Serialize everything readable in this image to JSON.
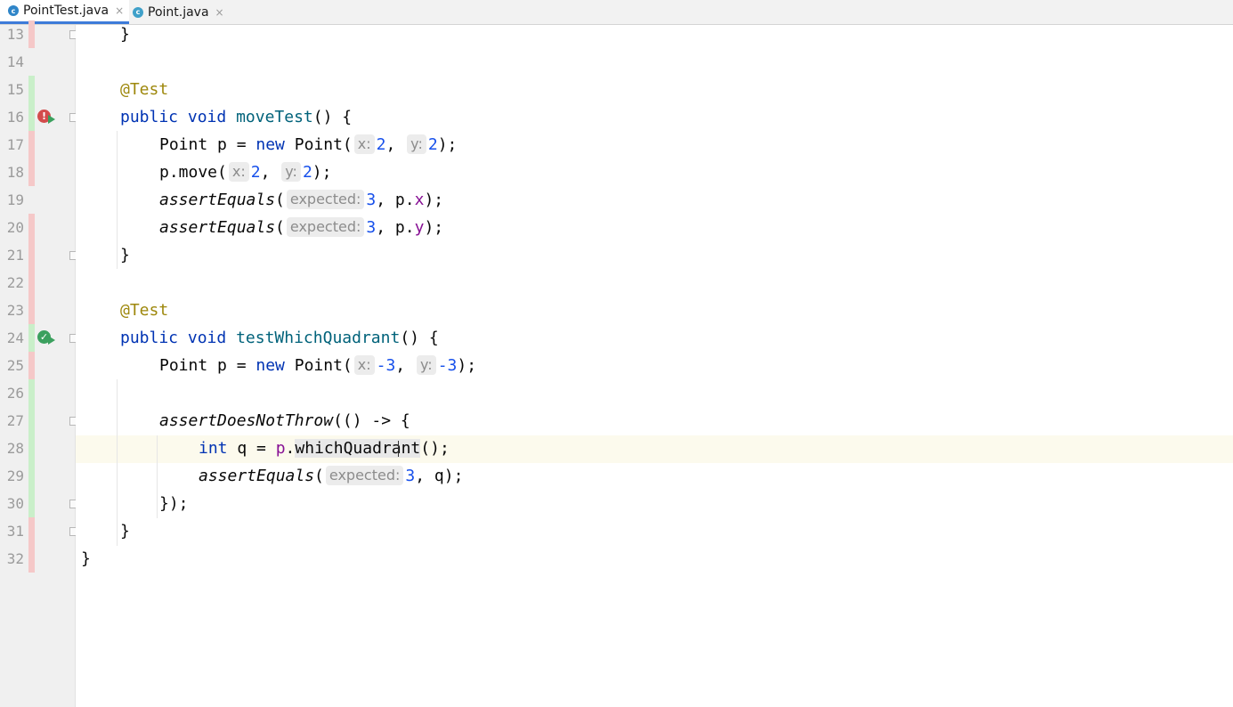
{
  "tabs": [
    {
      "label": "PointTest.java",
      "active": true,
      "icon": "java-test-class-icon",
      "icon_color": "#2f85c8",
      "close": "×"
    },
    {
      "label": "Point.java",
      "active": false,
      "icon": "java-class-icon",
      "icon_color": "#3fa0c9",
      "close": "×"
    }
  ],
  "colors": {
    "keyword": "#0033b3",
    "annotation": "#9e880d",
    "method_decl": "#00627a",
    "number": "#1750eb",
    "field": "#871094",
    "changed_line": "#f5c8c8",
    "added_line": "#c9efc9",
    "test_failed": "#d34c4c",
    "test_passed": "#3ba05e"
  },
  "editor": {
    "line_numbers": [
      "13",
      "14",
      "15",
      "16",
      "17",
      "18",
      "19",
      "20",
      "21",
      "22",
      "23",
      "24",
      "25",
      "26",
      "27",
      "28",
      "29",
      "30",
      "31",
      "32"
    ],
    "lines": {
      "l13": {
        "brace": "}"
      },
      "l15": {
        "annotation": "@Test"
      },
      "l16": {
        "kw1": "public",
        "kw2": "void",
        "name": "moveTest",
        "rest": "() {"
      },
      "l17": {
        "a": "Point p = ",
        "kw": "new",
        "b": " Point(",
        "hint1": "x:",
        "v1": "2",
        "c": ", ",
        "hint2": "y:",
        "v2": "2",
        "d": ");"
      },
      "l18": {
        "a": "p.move(",
        "hint1": "x:",
        "v1": "2",
        "c": ", ",
        "hint2": "y:",
        "v2": "2",
        "d": ");"
      },
      "l19": {
        "method": "assertEquals",
        "a": "(",
        "hint": "expected:",
        "v": "3",
        "b": ", p.",
        "field": "x",
        "c": ");"
      },
      "l20": {
        "method": "assertEquals",
        "a": "(",
        "hint": "expected:",
        "v": "3",
        "b": ", p.",
        "field": "y",
        "c": ");"
      },
      "l21": {
        "brace": "}"
      },
      "l23": {
        "annotation": "@Test"
      },
      "l24": {
        "kw1": "public",
        "kw2": "void",
        "name": "testWhichQuadrant",
        "rest": "() {"
      },
      "l25": {
        "a": "Point p = ",
        "kw": "new",
        "b": " Point(",
        "hint1": "x:",
        "v1": "-3",
        "c": ", ",
        "hint2": "y:",
        "v2": "-3",
        "d": ");"
      },
      "l27": {
        "method": "assertDoesNotThrow",
        "rest": "(() -> {"
      },
      "l28": {
        "kw": "int",
        "a": " q = ",
        "var": "p",
        "b": ".",
        "call": "whichQuadrant",
        "c": "();"
      },
      "l29": {
        "method": "assertEquals",
        "a": "(",
        "hint": "expected:",
        "v": "3",
        "b": ", q);"
      },
      "l30": {
        "text": "});"
      },
      "l31": {
        "brace": "}"
      },
      "l32": {
        "brace": "}"
      }
    }
  }
}
